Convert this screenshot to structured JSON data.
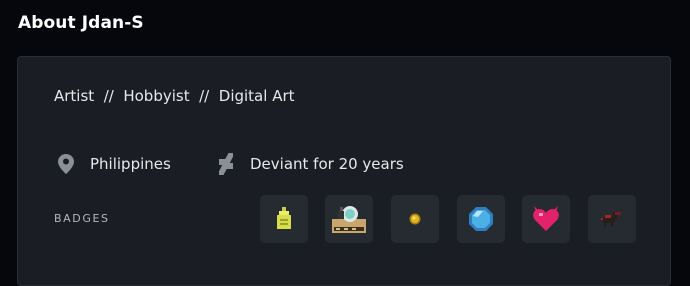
{
  "about": {
    "title": "About Jdan-S"
  },
  "profile": {
    "tagline": "Artist  //  Hobbyist  //  Digital Art",
    "location": "Philippines",
    "location_icon": "location-pin-icon",
    "membership": "Deviant for 20 years",
    "membership_icon": "deviantart-logo-icon"
  },
  "badges": {
    "label": "BADGES",
    "items": [
      {
        "icon": "lime-badge-icon",
        "color": "#d7de4a"
      },
      {
        "icon": "spaceship-badge-icon",
        "color": "#c9a66b"
      },
      {
        "icon": "gold-coin-badge-icon",
        "color": "#e2b51d"
      },
      {
        "icon": "blue-gem-badge-icon",
        "color": "#4ab0e6"
      },
      {
        "icon": "heart-badge-icon",
        "color": "#e2226a"
      },
      {
        "icon": "llama-badge-icon",
        "color": "#7a1c1c"
      }
    ]
  },
  "colors": {
    "page_bg": "#06070d",
    "card_bg": "#1a1d23",
    "badge_bg": "#262a31",
    "text": "#e8e8ea",
    "muted": "#b4b7bd",
    "icon_gray": "#8b8f98"
  }
}
